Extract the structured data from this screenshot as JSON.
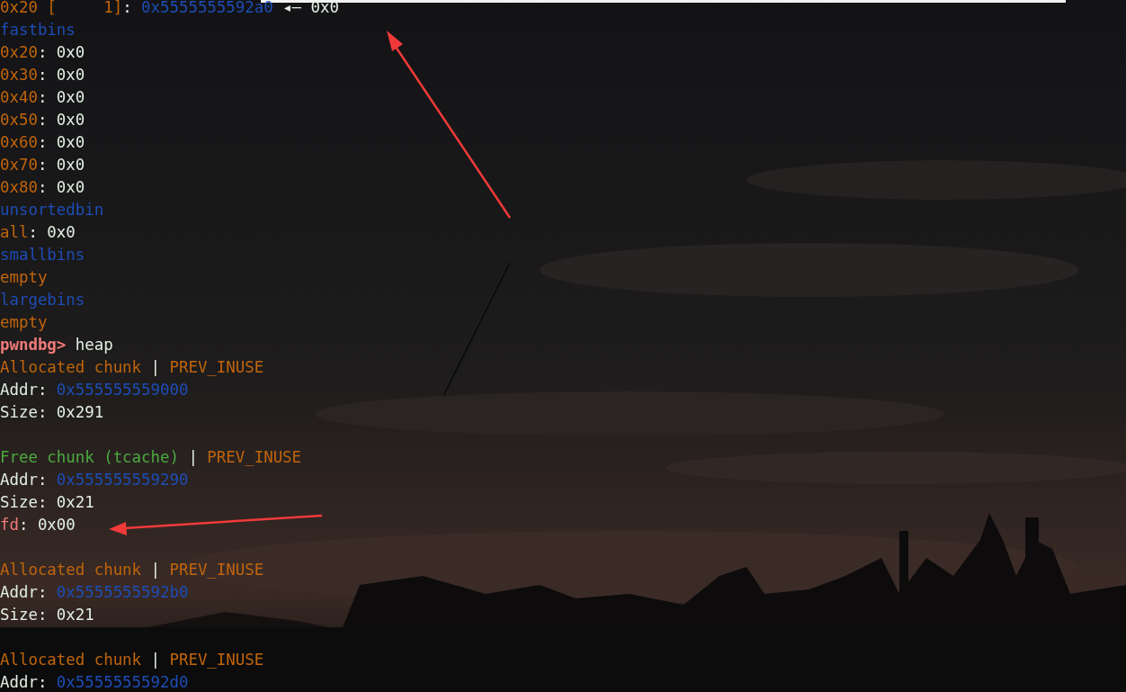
{
  "terminal": {
    "lines": [
      {
        "segments": [
          {
            "text": "0x20 [     1]",
            "kind": "label"
          },
          {
            "text": ": ",
            "kind": "plain"
          },
          {
            "text": "0x5555555592a0",
            "kind": "address"
          },
          {
            "text": " ◂— 0x0",
            "kind": "plain"
          }
        ]
      },
      {
        "segments": [
          {
            "text": "fastbins",
            "kind": "address"
          }
        ]
      },
      {
        "segments": [
          {
            "text": "0x20",
            "kind": "label"
          },
          {
            "text": ": 0x0",
            "kind": "plain"
          }
        ]
      },
      {
        "segments": [
          {
            "text": "0x30",
            "kind": "label"
          },
          {
            "text": ": 0x0",
            "kind": "plain"
          }
        ]
      },
      {
        "segments": [
          {
            "text": "0x40",
            "kind": "label"
          },
          {
            "text": ": 0x0",
            "kind": "plain"
          }
        ]
      },
      {
        "segments": [
          {
            "text": "0x50",
            "kind": "label"
          },
          {
            "text": ": 0x0",
            "kind": "plain"
          }
        ]
      },
      {
        "segments": [
          {
            "text": "0x60",
            "kind": "label"
          },
          {
            "text": ": 0x0",
            "kind": "plain"
          }
        ]
      },
      {
        "segments": [
          {
            "text": "0x70",
            "kind": "label"
          },
          {
            "text": ": 0x0",
            "kind": "plain"
          }
        ]
      },
      {
        "segments": [
          {
            "text": "0x80",
            "kind": "label"
          },
          {
            "text": ": 0x0",
            "kind": "plain"
          }
        ]
      },
      {
        "segments": [
          {
            "text": "unsortedbin",
            "kind": "address"
          }
        ]
      },
      {
        "segments": [
          {
            "text": "all",
            "kind": "label"
          },
          {
            "text": ": 0x0",
            "kind": "plain"
          }
        ]
      },
      {
        "segments": [
          {
            "text": "smallbins",
            "kind": "address"
          }
        ]
      },
      {
        "segments": [
          {
            "text": "empty",
            "kind": "label"
          }
        ]
      },
      {
        "segments": [
          {
            "text": "largebins",
            "kind": "address"
          }
        ]
      },
      {
        "segments": [
          {
            "text": "empty",
            "kind": "label"
          }
        ]
      },
      {
        "segments": [
          {
            "text": "pwndbg>",
            "kind": "prompt"
          },
          {
            "text": " heap",
            "kind": "plain"
          }
        ]
      },
      {
        "segments": [
          {
            "text": "Allocated chunk",
            "kind": "label"
          },
          {
            "text": " | ",
            "kind": "plain"
          },
          {
            "text": "PREV_INUSE",
            "kind": "label"
          }
        ]
      },
      {
        "segments": [
          {
            "text": "Addr: ",
            "kind": "plain"
          },
          {
            "text": "0x555555559000",
            "kind": "address"
          }
        ]
      },
      {
        "segments": [
          {
            "text": "Size: 0x291",
            "kind": "plain"
          }
        ]
      },
      {
        "kind": "blank"
      },
      {
        "segments": [
          {
            "text": "Free chunk (tcache)",
            "kind": "free"
          },
          {
            "text": " | ",
            "kind": "plain"
          },
          {
            "text": "PREV_INUSE",
            "kind": "label"
          }
        ]
      },
      {
        "segments": [
          {
            "text": "Addr: ",
            "kind": "plain"
          },
          {
            "text": "0x555555559290",
            "kind": "address"
          }
        ]
      },
      {
        "segments": [
          {
            "text": "Size: 0x21",
            "kind": "plain"
          }
        ]
      },
      {
        "segments": [
          {
            "text": "fd",
            "kind": "field"
          },
          {
            "text": ": 0x00",
            "kind": "plain"
          }
        ]
      },
      {
        "kind": "blank"
      },
      {
        "segments": [
          {
            "text": "Allocated chunk",
            "kind": "label"
          },
          {
            "text": " | ",
            "kind": "plain"
          },
          {
            "text": "PREV_INUSE",
            "kind": "label"
          }
        ]
      },
      {
        "segments": [
          {
            "text": "Addr: ",
            "kind": "plain"
          },
          {
            "text": "0x5555555592b0",
            "kind": "address"
          }
        ]
      },
      {
        "segments": [
          {
            "text": "Size: 0x21",
            "kind": "plain"
          }
        ]
      },
      {
        "kind": "blank"
      },
      {
        "segments": [
          {
            "text": "Allocated chunk",
            "kind": "label"
          },
          {
            "text": " | ",
            "kind": "plain"
          },
          {
            "text": "PREV_INUSE",
            "kind": "label"
          }
        ]
      },
      {
        "segments": [
          {
            "text": "Addr: ",
            "kind": "plain"
          },
          {
            "text": "0x5555555592d0",
            "kind": "address"
          }
        ]
      }
    ]
  }
}
